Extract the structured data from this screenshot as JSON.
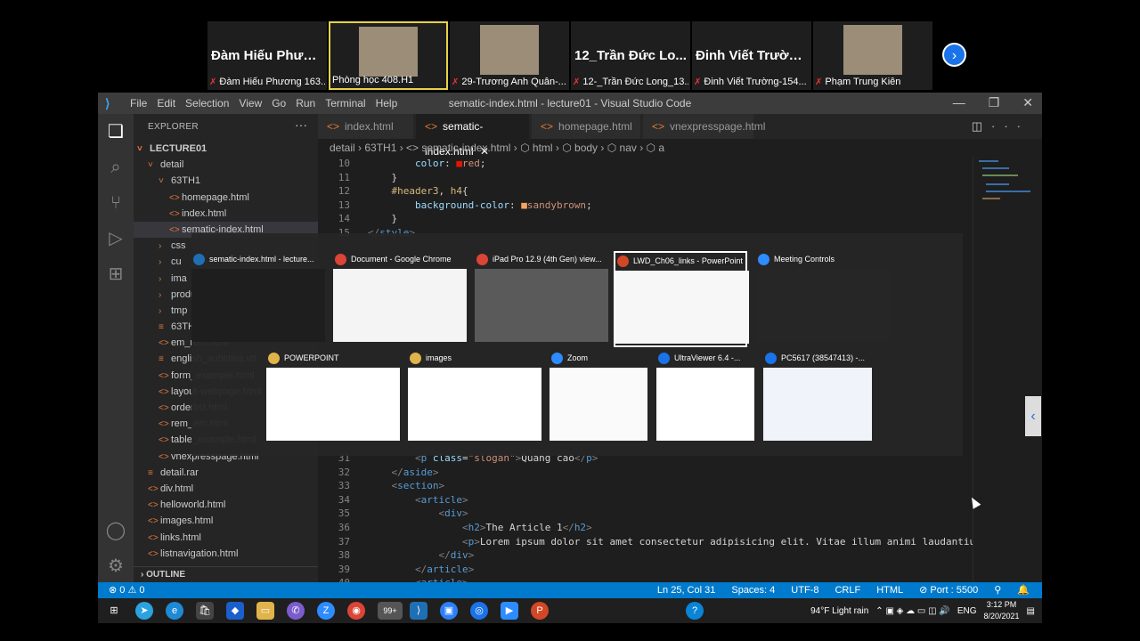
{
  "zoom": {
    "participants": [
      {
        "name": "Đàm Hiếu Phươ...",
        "caption": "Đàm Hiếu Phương 163...",
        "video": false,
        "muted": true
      },
      {
        "name": "",
        "caption": "Phòng học 408.H1",
        "video": true,
        "muted": false,
        "active": true
      },
      {
        "name": "",
        "caption": "29-Trương Anh Quân-...",
        "video": true,
        "muted": true
      },
      {
        "name": "12_Trần Đức Lo...",
        "caption": "12-_Trần Đức Long_13...",
        "video": false,
        "muted": true
      },
      {
        "name": "Đinh Viết Trường...",
        "caption": "Đinh Viết Trường-154...",
        "video": false,
        "muted": true
      },
      {
        "name": "",
        "caption": "Phạm Trung Kiên",
        "video": true,
        "muted": true
      }
    ]
  },
  "vscode": {
    "title": "sematic-index.html - lecture01 - Visual Studio Code",
    "menu": [
      "File",
      "Edit",
      "Selection",
      "View",
      "Go",
      "Run",
      "Terminal",
      "Help"
    ],
    "explorer_title": "EXPLORER",
    "tree": [
      {
        "label": "LECTURE01",
        "indent": 0,
        "chev": "˅",
        "bold": true
      },
      {
        "label": "detail",
        "indent": 1,
        "chev": "˅"
      },
      {
        "label": "63TH1",
        "indent": 2,
        "chev": "˅"
      },
      {
        "label": "homepage.html",
        "indent": 3,
        "icon": "<>"
      },
      {
        "label": "index.html",
        "indent": 3,
        "icon": "<>"
      },
      {
        "label": "sematic-index.html",
        "indent": 3,
        "icon": "<>",
        "selected": true
      },
      {
        "label": "css",
        "indent": 2,
        "chev": "›"
      },
      {
        "label": "cu",
        "indent": 2,
        "chev": "›"
      },
      {
        "label": "ima",
        "indent": 2,
        "chev": "›"
      },
      {
        "label": "produ",
        "indent": 2,
        "chev": "›"
      },
      {
        "label": "tmp",
        "indent": 2,
        "chev": "›"
      },
      {
        "label": "63TH1",
        "indent": 2,
        "icon": "≡"
      },
      {
        "label": "em_rem.html",
        "indent": 2,
        "icon": "<>"
      },
      {
        "label": "english_subtitles.vtt",
        "indent": 2,
        "icon": "≡"
      },
      {
        "label": "form_example.html",
        "indent": 2,
        "icon": "<>"
      },
      {
        "label": "layout-webpage.html",
        "indent": 2,
        "icon": "<>"
      },
      {
        "label": "orderlist.html",
        "indent": 2,
        "icon": "<>"
      },
      {
        "label": "rem_em.html",
        "indent": 2,
        "icon": "<>"
      },
      {
        "label": "table_example.html",
        "indent": 2,
        "icon": "<>"
      },
      {
        "label": "vnexpresspage.html",
        "indent": 2,
        "icon": "<>"
      },
      {
        "label": "detail.rar",
        "indent": 1,
        "icon": "≡"
      },
      {
        "label": "div.html",
        "indent": 1,
        "icon": "<>"
      },
      {
        "label": "helloworld.html",
        "indent": 1,
        "icon": "<>"
      },
      {
        "label": "images.html",
        "indent": 1,
        "icon": "<>"
      },
      {
        "label": "links.html",
        "indent": 1,
        "icon": "<>"
      },
      {
        "label": "listnavigation.html",
        "indent": 1,
        "icon": "<>"
      }
    ],
    "outline_label": "OUTLINE",
    "tabs": [
      {
        "label": "index.html",
        "active": false
      },
      {
        "label": "sematic-index.html",
        "active": true
      },
      {
        "label": "homepage.html",
        "active": false
      },
      {
        "label": "vnexpresspage.html",
        "active": false
      }
    ],
    "breadcrumb": "detail › 63TH1 › <> sematic-index.html › ⬡ html › ⬡ body › ⬡ nav › ⬡ a",
    "code_top": [
      {
        "n": "10",
        "html": "        <span class='p'>color</span>: <span style='color:#e51400'>■</span><span class='v'>red</span>;"
      },
      {
        "n": "11",
        "html": "    }"
      },
      {
        "n": "12",
        "html": "    <span class='sl'>#header3</span>, <span class='sl'>h4</span>{"
      },
      {
        "n": "13",
        "html": "        <span class='p'>background-color</span>: <span style='color:#f4a460'>■</span><span class='v'>sandybrown</span>;"
      },
      {
        "n": "14",
        "html": "    }"
      },
      {
        "n": "15",
        "html": "<span class='g'>&lt;/</span><span class='k'>style</span><span class='g'>&gt;</span>"
      }
    ],
    "code_bottom": [
      {
        "n": "31",
        "html": "        <span class='g'>&lt;</span><span class='k'>p</span> <span class='p'>class</span>=<span class='v'>\"slogan\"</span><span class='g'>&gt;</span>Quang cao<span class='g'>&lt;/</span><span class='k'>p</span><span class='g'>&gt;</span>"
      },
      {
        "n": "32",
        "html": "    <span class='g'>&lt;/</span><span class='k'>aside</span><span class='g'>&gt;</span>"
      },
      {
        "n": "33",
        "html": "    <span class='g'>&lt;</span><span class='k'>section</span><span class='g'>&gt;</span>"
      },
      {
        "n": "34",
        "html": "        <span class='g'>&lt;</span><span class='k'>article</span><span class='g'>&gt;</span>"
      },
      {
        "n": "35",
        "html": "            <span class='g'>&lt;</span><span class='k'>div</span><span class='g'>&gt;</span>"
      },
      {
        "n": "36",
        "html": "                <span class='g'>&lt;</span><span class='k'>h2</span><span class='g'>&gt;</span>The Article 1<span class='g'>&lt;/</span><span class='k'>h2</span><span class='g'>&gt;</span>"
      },
      {
        "n": "37",
        "html": "                <span class='g'>&lt;</span><span class='k'>p</span><span class='g'>&gt;</span>Lorem ipsum dolor sit amet consectetur adipisicing elit. Vitae illum animi laudantiu"
      },
      {
        "n": "38",
        "html": "            <span class='g'>&lt;/</span><span class='k'>div</span><span class='g'>&gt;</span>"
      },
      {
        "n": "39",
        "html": "        <span class='g'>&lt;/</span><span class='k'>article</span><span class='g'>&gt;</span>"
      },
      {
        "n": "40",
        "html": "        <span class='g'>&lt;</span><span class='k'>article</span><span class='g'>&gt;</span>"
      }
    ],
    "status": {
      "left": "⊗ 0 ⚠ 0",
      "items": [
        "Ln 25, Col 31",
        "Spaces: 4",
        "UTF-8",
        "CRLF",
        "HTML",
        "⊘ Port : 5500",
        "⚲",
        "🔔"
      ]
    }
  },
  "switcher": {
    "windows": [
      {
        "title": "sematic-index.html - lecture...",
        "icon": "vscode-icon",
        "color": "#1e1e1e",
        "row": 0
      },
      {
        "title": "Document - Google Chrome",
        "icon": "chrome-icon",
        "color": "#f4f4f4",
        "row": 0
      },
      {
        "title": "iPad Pro 12.9 (4th Gen) view...",
        "icon": "chrome-icon",
        "color": "#5a5a5a",
        "row": 0
      },
      {
        "title": "LWD_Ch06_links - PowerPoint",
        "icon": "powerpoint-icon",
        "color": "#f7f7f7",
        "row": 0,
        "selected": true
      },
      {
        "title": "Meeting Controls",
        "icon": "zoom-icon",
        "color": "#262626",
        "row": 0
      },
      {
        "title": "POWERPOINT",
        "icon": "folder-icon",
        "color": "#ffffff",
        "row": 1
      },
      {
        "title": "images",
        "icon": "folder-icon",
        "color": "#ffffff",
        "row": 1
      },
      {
        "title": "Zoom",
        "icon": "zoom-icon",
        "color": "#fafafa",
        "row": 1
      },
      {
        "title": "UltraViewer 6.4 -...",
        "icon": "ultraviewer-icon",
        "color": "#ffffff",
        "row": 1
      },
      {
        "title": "PC5617 (38547413) -...",
        "icon": "ultraviewer-icon",
        "color": "#f0f4fa",
        "row": 1
      }
    ]
  },
  "taskbar": {
    "weather": "94°F  Light rain",
    "lang": "ENG",
    "time": "3:12 PM",
    "date": "8/20/2021",
    "badge": "99+"
  }
}
